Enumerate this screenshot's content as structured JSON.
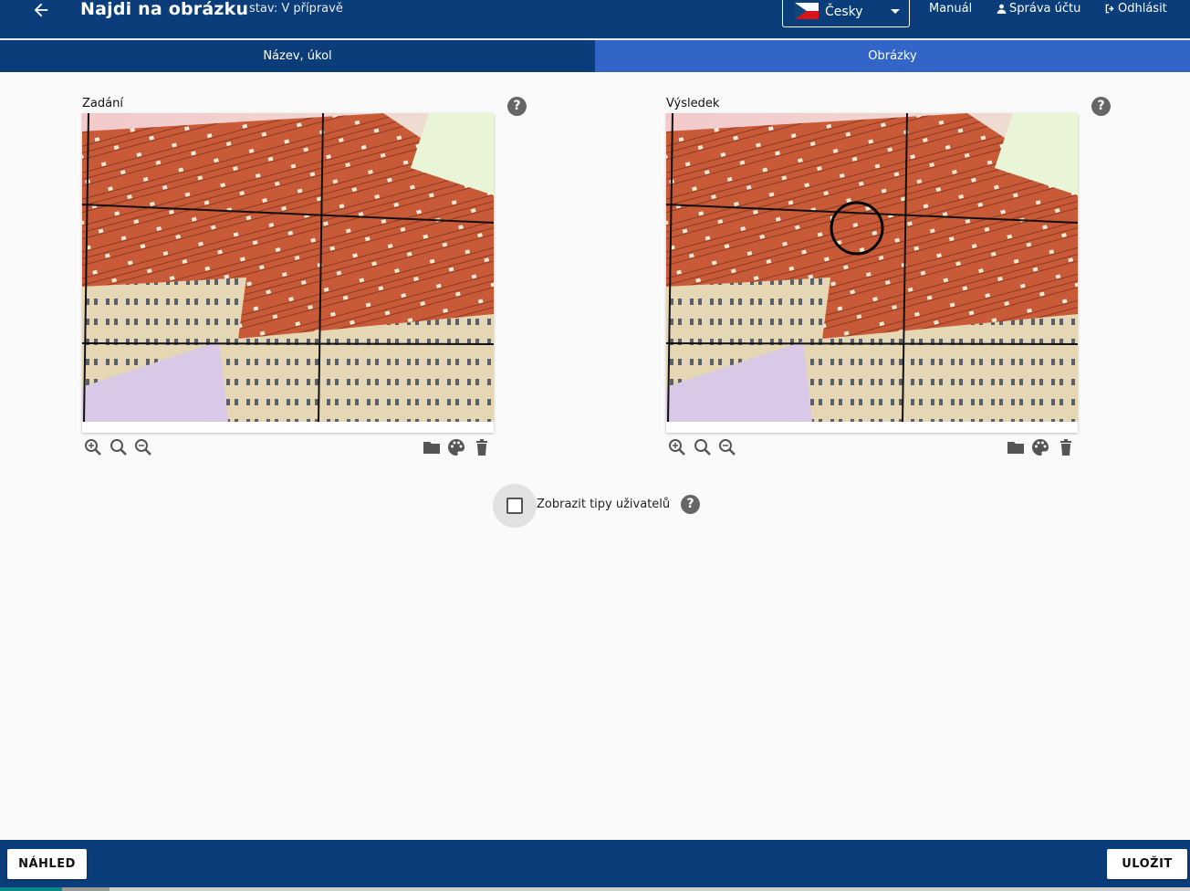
{
  "header": {
    "title": "Najdi na obrázku",
    "state": "stav: V přípravě",
    "language": "Česky",
    "links": {
      "manual": "Manuál",
      "account": "Správa účtu",
      "logout": "Odhlásit"
    }
  },
  "tabs": [
    {
      "label": "Název, úkol",
      "active": false
    },
    {
      "label": "Obrázky",
      "active": true
    }
  ],
  "panels": {
    "left": {
      "label": "Zadání",
      "has_target_circle": false
    },
    "right": {
      "label": "Výsledek",
      "has_target_circle": true
    }
  },
  "help_glyph": "?",
  "show_tips": {
    "label": "Zobrazit tipy uživatelů",
    "checked": false
  },
  "footer": {
    "preview": "NÁHLED",
    "save": "ULOŽIT"
  },
  "colors": {
    "header": "#0a3d7a",
    "tab_active": "#3365c8",
    "background": "#fafafa"
  },
  "icons": [
    "arrow-left-icon",
    "czech-flag-icon",
    "user-icon",
    "logout-icon",
    "help-icon",
    "zoom-fit-icon",
    "zoom-in-icon",
    "zoom-out-icon",
    "folder-icon",
    "palette-icon",
    "trash-icon"
  ]
}
